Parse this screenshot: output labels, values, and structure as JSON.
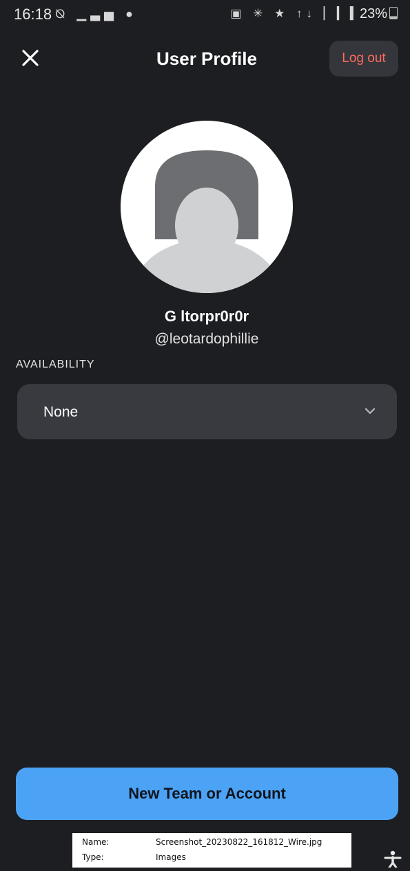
{
  "status_bar": {
    "time": "16:18",
    "left_icons": "⦰ ▁▃▅ ●",
    "right_icons": "▣ ✳ ★ ↑↓ ▏▎▍",
    "battery_text": "23%"
  },
  "header": {
    "title": "User Profile",
    "close_icon": "close-icon",
    "logout_label": "Log out"
  },
  "profile": {
    "display_name": "G ltorpr0r0r",
    "handle": "@leotardophillie",
    "avatar_icon": "default-avatar-icon"
  },
  "availability": {
    "section_label": "AVAILABILITY",
    "selected_value": "None",
    "dropdown_icon": "chevron-down-icon"
  },
  "actions": {
    "new_team_label": "New Team or Account"
  },
  "file_info": {
    "name_label": "Name:",
    "name_value": "Screenshot_20230822_161812_Wire.jpg",
    "type_label": "Type:",
    "type_value": "Images"
  },
  "colors": {
    "background": "#1d1e21",
    "logout_text": "#ff6b5e",
    "primary_button": "#4ca3f5",
    "select_background": "#383a40"
  },
  "accessibility_icon": "accessibility-icon"
}
